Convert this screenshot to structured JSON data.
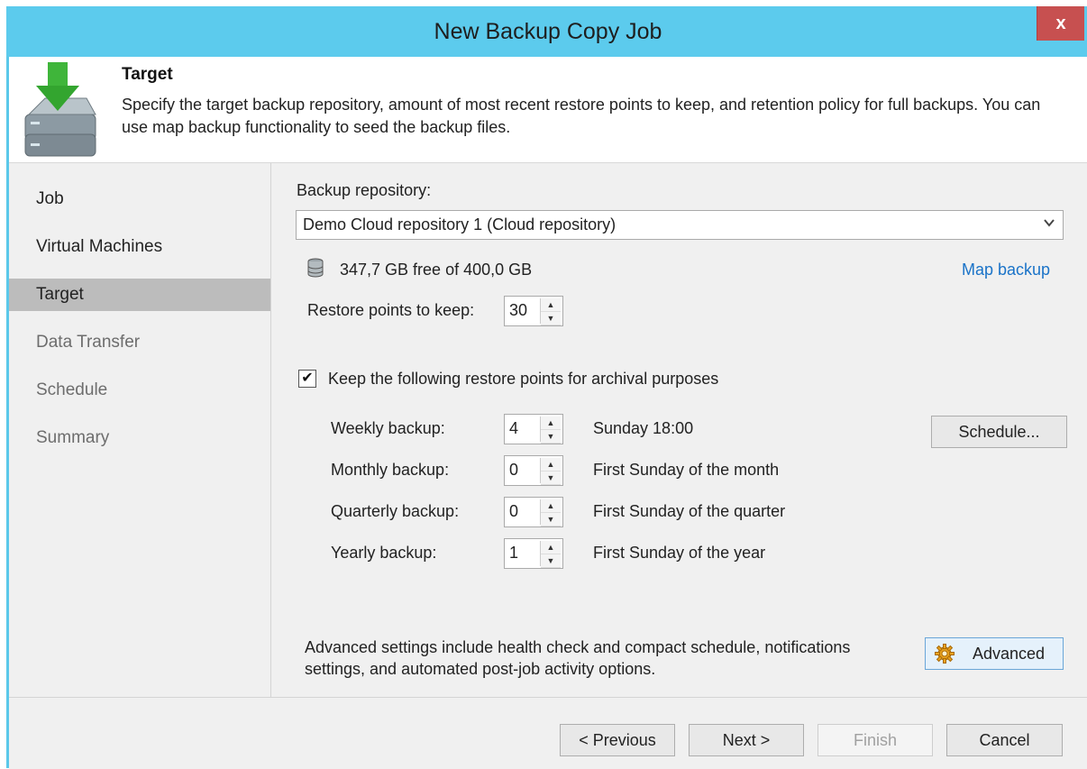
{
  "window": {
    "title": "New Backup Copy Job",
    "close_label": "x"
  },
  "header": {
    "title": "Target",
    "description": "Specify the target backup repository, amount of most recent restore points to keep, and retention policy for full backups. You can use map backup functionality to seed the backup files."
  },
  "nav": {
    "items": [
      {
        "label": "Job",
        "state": "normal"
      },
      {
        "label": "Virtual Machines",
        "state": "normal"
      },
      {
        "label": "Target",
        "state": "active"
      },
      {
        "label": "Data Transfer",
        "state": "disabled"
      },
      {
        "label": "Schedule",
        "state": "disabled"
      },
      {
        "label": "Summary",
        "state": "disabled"
      }
    ]
  },
  "target": {
    "repository_label": "Backup repository:",
    "repository_value": "Demo Cloud repository 1 (Cloud repository)",
    "free_space": "347,7 GB free of 400,0 GB",
    "map_backup_link": "Map backup",
    "restore_points_label": "Restore points to keep:",
    "restore_points_value": "30",
    "archival_checkbox_label": "Keep the following restore points for archival purposes",
    "archival_checked": true,
    "archival": [
      {
        "label": "Weekly backup:",
        "value": "4",
        "schedule": "Sunday 18:00"
      },
      {
        "label": "Monthly backup:",
        "value": "0",
        "schedule": "First Sunday of the month"
      },
      {
        "label": "Quarterly backup:",
        "value": "0",
        "schedule": "First Sunday of the quarter"
      },
      {
        "label": "Yearly backup:",
        "value": "1",
        "schedule": "First Sunday of the year"
      }
    ],
    "schedule_button": "Schedule...",
    "advanced_text_line1": "Advanced settings include health check and compact schedule, notifications",
    "advanced_text_line2": "settings, and automated post-job activity options.",
    "advanced_button": "Advanced"
  },
  "footer": {
    "previous": "< Previous",
    "next": "Next >",
    "finish": "Finish",
    "cancel": "Cancel"
  },
  "icons": {
    "header": "backup-target-icon",
    "database": "database-icon",
    "gear": "gear-icon",
    "checkmark": "✔",
    "spin_up": "▲",
    "spin_down": "▼",
    "dropdown": "chevron-down-icon"
  },
  "colors": {
    "titlebar": "#5ccbed",
    "close": "#c75050",
    "nav_active": "#bcbcbc",
    "link": "#1a73c8"
  }
}
